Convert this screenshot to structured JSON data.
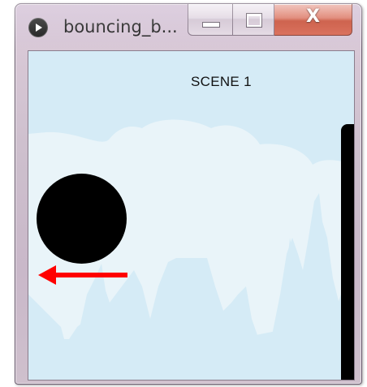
{
  "window": {
    "title": "bouncing_b...",
    "app_icon": "processing-play-icon",
    "buttons": {
      "minimize": "minimize-icon",
      "maximize": "maximize-icon",
      "close_label": "X"
    }
  },
  "sketch": {
    "scene_label": "SCENE 1",
    "colors": {
      "sky": "#d5ebf6",
      "clouds": "#e9f4f9",
      "ball": "#000000",
      "paddle": "#000000",
      "arrow": "#ff0000"
    },
    "ball_direction": "left"
  }
}
